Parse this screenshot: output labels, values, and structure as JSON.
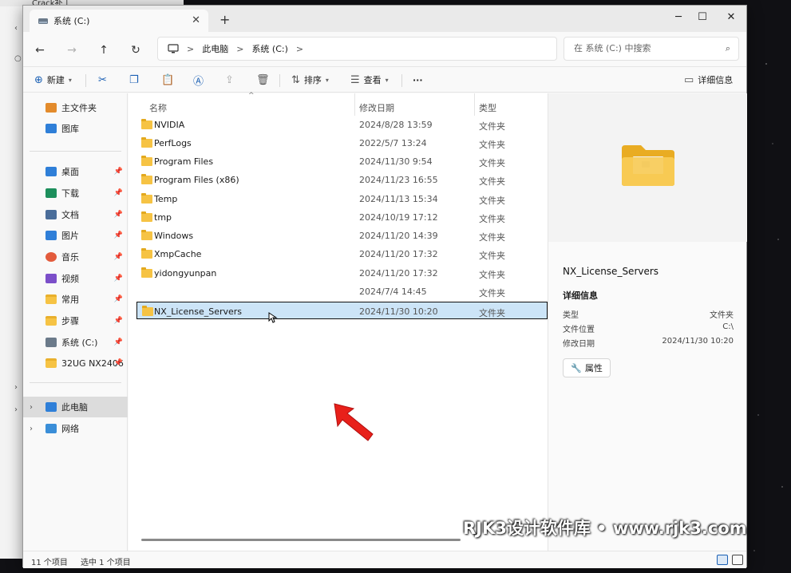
{
  "background_window": {
    "tab_label": "Crack补丁"
  },
  "window": {
    "tab_label": "系统 (C:)",
    "new_tab": "+"
  },
  "address": {
    "crumbs": [
      "此电脑",
      "系统 (C:)"
    ],
    "search_placeholder": "在 系统 (C:) 中搜索"
  },
  "toolbar": {
    "new_label": "新建",
    "sort_label": "排序",
    "view_label": "查看",
    "more_label": "···",
    "details_label": "详细信息"
  },
  "nav": {
    "quick": [
      {
        "label": "主文件夹",
        "icon": "home-icon"
      },
      {
        "label": "图库",
        "icon": "gallery-icon"
      }
    ],
    "pinned": [
      {
        "label": "桌面",
        "color": "#2f7fd8"
      },
      {
        "label": "下载",
        "color": "#1d8f5c"
      },
      {
        "label": "文档",
        "color": "#4a6d9a"
      },
      {
        "label": "图片",
        "color": "#2f7fd8"
      },
      {
        "label": "音乐",
        "color": "#e35b3c"
      },
      {
        "label": "视频",
        "color": "#7b4fc9"
      },
      {
        "label": "常用",
        "color": "#f6c344"
      },
      {
        "label": "步骤",
        "color": "#f6c344"
      },
      {
        "label": "系统 (C:)",
        "color": "#6b7a8a"
      },
      {
        "label": "32UG NX2406",
        "color": "#f6c344"
      }
    ],
    "tree": [
      {
        "label": "此电脑",
        "icon": "monitor-icon"
      },
      {
        "label": "网络",
        "icon": "network-icon"
      }
    ]
  },
  "columns": {
    "name": "名称",
    "date": "修改日期",
    "type": "类型"
  },
  "files": [
    {
      "name": "NVIDIA",
      "date": "2024/8/28 13:59",
      "type": "文件夹"
    },
    {
      "name": "PerfLogs",
      "date": "2022/5/7 13:24",
      "type": "文件夹"
    },
    {
      "name": "Program Files",
      "date": "2024/11/30 9:54",
      "type": "文件夹"
    },
    {
      "name": "Program Files (x86)",
      "date": "2024/11/23 16:55",
      "type": "文件夹"
    },
    {
      "name": "Temp",
      "date": "2024/11/13 15:34",
      "type": "文件夹"
    },
    {
      "name": "tmp",
      "date": "2024/10/19 17:12",
      "type": "文件夹"
    },
    {
      "name": "Windows",
      "date": "2024/11/20 14:39",
      "type": "文件夹"
    },
    {
      "name": "XmpCache",
      "date": "2024/11/20 17:32",
      "type": "文件夹"
    },
    {
      "name": "yidongyunpan",
      "date": "2024/11/20 17:32",
      "type": "文件夹"
    },
    {
      "name": "",
      "date": "2024/7/4 14:45",
      "type": "文件夹"
    },
    {
      "name": "NX_License_Servers",
      "date": "2024/11/30 10:20",
      "type": "文件夹",
      "selected": true
    }
  ],
  "details": {
    "title": "NX_License_Servers",
    "section": "详细信息",
    "rows": [
      {
        "key": "类型",
        "value": "文件夹"
      },
      {
        "key": "文件位置",
        "value": "C:\\"
      },
      {
        "key": "修改日期",
        "value": "2024/11/30 10:20"
      }
    ],
    "properties_button": "属性"
  },
  "status": {
    "count": "11 个项目",
    "selected": "选中 1 个项目"
  },
  "watermark": "RJK3设计软件库 • www.rjk3.com",
  "colors": {
    "selection_bg": "#cce4f7",
    "folder": "#f6c344",
    "accent": "#1a5fb4"
  }
}
